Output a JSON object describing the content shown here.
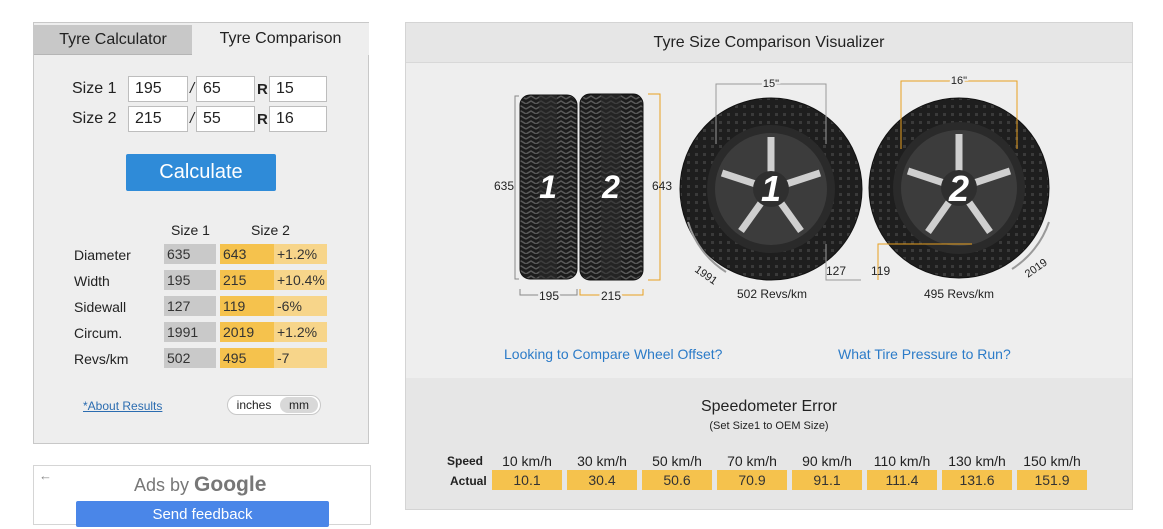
{
  "tabs": {
    "calculator": "Tyre Calculator",
    "comparison": "Tyre Comparison"
  },
  "form": {
    "size1_label": "Size 1",
    "size2_label": "Size 2",
    "slash": "/",
    "r": "R",
    "size1": {
      "width": "195",
      "aspect": "65",
      "rim": "15"
    },
    "size2": {
      "width": "215",
      "aspect": "55",
      "rim": "16"
    },
    "calculate_label": "Calculate"
  },
  "results": {
    "col1": "Size 1",
    "col2": "Size 2",
    "rows": [
      {
        "label": "Diameter",
        "v1": "635",
        "v2": "643",
        "diff": "+1.2%"
      },
      {
        "label": "Width",
        "v1": "195",
        "v2": "215",
        "diff": "+10.4%"
      },
      {
        "label": "Sidewall",
        "v1": "127",
        "v2": "119",
        "diff": "-6%"
      },
      {
        "label": "Circum.",
        "v1": "1991",
        "v2": "2019",
        "diff": "+1.2%"
      },
      {
        "label": "Revs/km",
        "v1": "502",
        "v2": "495",
        "diff": "-7"
      }
    ],
    "about_link": "*About Results",
    "unit_inches": "inches",
    "unit_mm": "mm",
    "unit_selected": "mm"
  },
  "ads": {
    "back_icon": "back-arrow-icon",
    "ads_by": "Ads by",
    "google": "Google",
    "feedback": "Send feedback"
  },
  "visualizer": {
    "title": "Tyre Size Comparison Visualizer",
    "tread1_number": "1",
    "tread2_number": "2",
    "height1": "635",
    "height2": "643",
    "width1": "195",
    "width2": "215",
    "wheel1": {
      "number": "1",
      "rim": "15\"",
      "sidewall": "127",
      "circum": "1991",
      "revs": "502 Revs/km"
    },
    "wheel2": {
      "number": "2",
      "rim": "16\"",
      "sidewall": "119",
      "circum": "2019",
      "revs": "495 Revs/km"
    },
    "link_offset": "Looking to Compare Wheel Offset?",
    "link_pressure": "What Tire Pressure to Run?"
  },
  "speedometer": {
    "title": "Speedometer Error",
    "subtitle": "(Set Size1 to OEM Size)",
    "speed_label": "Speed",
    "actual_label": "Actual",
    "speeds": [
      "10 km/h",
      "30 km/h",
      "50 km/h",
      "70 km/h",
      "90 km/h",
      "110 km/h",
      "130 km/h",
      "150 km/h"
    ],
    "actual": [
      "10.1",
      "30.4",
      "50.6",
      "70.9",
      "91.1",
      "111.4",
      "131.6",
      "151.9"
    ]
  },
  "colors": {
    "accent_blue": "#2f8bd8",
    "highlight_orange": "#f5c24d",
    "light_orange": "#f7d58a",
    "grey_cell": "#c9c9c9",
    "guide_line": "#e8a020"
  }
}
